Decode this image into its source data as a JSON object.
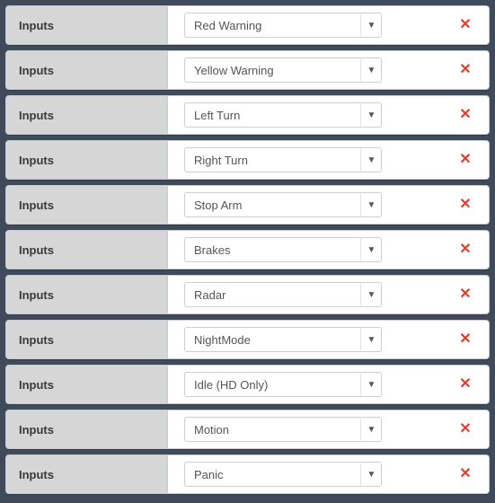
{
  "row_label": "Inputs",
  "delete_glyph": "✕",
  "caret_glyph": "▼",
  "rows": [
    {
      "value": "Red Warning"
    },
    {
      "value": "Yellow Warning"
    },
    {
      "value": "Left Turn"
    },
    {
      "value": "Right Turn"
    },
    {
      "value": "Stop Arm"
    },
    {
      "value": "Brakes"
    },
    {
      "value": "Radar"
    },
    {
      "value": "NightMode"
    },
    {
      "value": "Idle (HD Only)"
    },
    {
      "value": "Motion"
    },
    {
      "value": "Panic"
    }
  ]
}
